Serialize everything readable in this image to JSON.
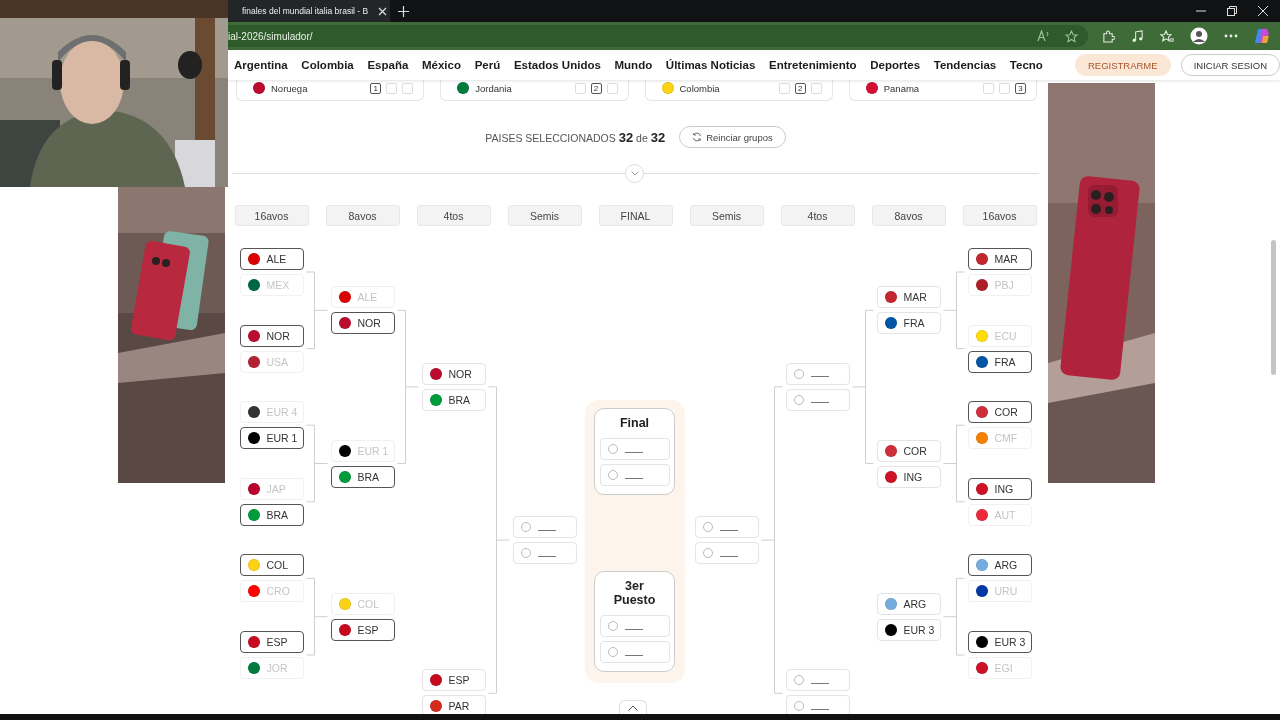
{
  "browser": {
    "tab_title": "finales del mundial italia brasil - B",
    "url": "ial-2026/simulador/"
  },
  "nav": {
    "links": [
      "Argentina",
      "Colombia",
      "España",
      "México",
      "Perú",
      "Estados Unidos",
      "Mundo",
      "Últimas Noticias",
      "Entretenimiento",
      "Deportes",
      "Tendencias",
      "Tecno"
    ],
    "register": "REGISTRARME",
    "login": "INICIAR SESION"
  },
  "groups": [
    {
      "name": "Noruega",
      "color": "#ba0c2f",
      "boxes": [
        {
          "kind": "number",
          "text": "1"
        },
        {
          "kind": "blank"
        },
        {
          "kind": "blank"
        }
      ]
    },
    {
      "name": "Jordania",
      "color": "#007a3d",
      "boxes": [
        {
          "kind": "blank"
        },
        {
          "kind": "number",
          "text": "2"
        },
        {
          "kind": "blank"
        }
      ]
    },
    {
      "name": "Colombia",
      "color": "#fcd116",
      "boxes": [
        {
          "kind": "blank"
        },
        {
          "kind": "number",
          "text": "2"
        },
        {
          "kind": "blank"
        }
      ]
    },
    {
      "name": "Panama",
      "color": "#d21034",
      "boxes": [
        {
          "kind": "blank"
        },
        {
          "kind": "blank"
        },
        {
          "kind": "number",
          "text": "3"
        }
      ]
    }
  ],
  "summary": {
    "label": "PAISES SELECCIONADOS",
    "count": "32",
    "joiner": "de",
    "total": "32",
    "reset_button": "Reinciar grupos"
  },
  "round_headers": [
    "16avos",
    "8avos",
    "4tos",
    "Semis",
    "FINAL",
    "Semis",
    "4tos",
    "8avos",
    "16avos"
  ],
  "bracket": {
    "left": [
      [
        {
          "kind": "team",
          "code": "ALE",
          "selected": true,
          "eliminated": false,
          "color": "#dd0000"
        },
        {
          "kind": "team",
          "code": "MEX",
          "selected": false,
          "eliminated": true,
          "color": "#006847"
        },
        {
          "kind": "team",
          "code": "NOR",
          "selected": true,
          "eliminated": false,
          "color": "#ba0c2f"
        },
        {
          "kind": "team",
          "code": "USA",
          "selected": false,
          "eliminated": true,
          "color": "#b22234"
        },
        {
          "kind": "team",
          "code": "EUR 4",
          "selected": false,
          "eliminated": true,
          "color": "#333333"
        },
        {
          "kind": "team",
          "code": "EUR 1",
          "selected": true,
          "eliminated": false,
          "color": "#000000"
        },
        {
          "kind": "team",
          "code": "JAP",
          "selected": false,
          "eliminated": true,
          "color": "#bc002d"
        },
        {
          "kind": "team",
          "code": "BRA",
          "selected": true,
          "eliminated": false,
          "color": "#009c3b"
        },
        {
          "kind": "team",
          "code": "COL",
          "selected": true,
          "eliminated": false,
          "color": "#fcd116"
        },
        {
          "kind": "team",
          "code": "CRO",
          "selected": false,
          "eliminated": true,
          "color": "#ff0000"
        },
        {
          "kind": "team",
          "code": "ESP",
          "selected": true,
          "eliminated": false,
          "color": "#c60b1e"
        },
        {
          "kind": "team",
          "code": "JOR",
          "selected": false,
          "eliminated": true,
          "color": "#007a3d"
        }
      ],
      [
        {
          "kind": "team",
          "code": "ALE",
          "selected": false,
          "eliminated": true,
          "color": "#dd0000"
        },
        {
          "kind": "team",
          "code": "NOR",
          "selected": true,
          "eliminated": false,
          "color": "#ba0c2f"
        },
        {
          "kind": "team",
          "code": "EUR 1",
          "selected": false,
          "eliminated": true,
          "color": "#000000"
        },
        {
          "kind": "team",
          "code": "BRA",
          "selected": true,
          "eliminated": false,
          "color": "#009c3b"
        },
        {
          "kind": "team",
          "code": "COL",
          "selected": false,
          "eliminated": true,
          "color": "#fcd116"
        },
        {
          "kind": "team",
          "code": "ESP",
          "selected": true,
          "eliminated": false,
          "color": "#c60b1e"
        }
      ],
      [
        {
          "kind": "team",
          "code": "NOR",
          "selected": false,
          "eliminated": false,
          "color": "#ba0c2f"
        },
        {
          "kind": "team",
          "code": "BRA",
          "selected": false,
          "eliminated": false,
          "color": "#009c3b"
        },
        {
          "kind": "team",
          "code": "ESP",
          "selected": false,
          "eliminated": false,
          "color": "#c60b1e"
        },
        {
          "kind": "team",
          "code": "PAR",
          "selected": false,
          "eliminated": false,
          "color": "#d52b1e"
        }
      ],
      [
        {
          "kind": "empty",
          "checked": false
        },
        {
          "kind": "empty",
          "checked": false
        }
      ]
    ],
    "right": [
      [
        {
          "kind": "empty",
          "checked": false
        },
        {
          "kind": "empty",
          "checked": false
        }
      ],
      [
        {
          "kind": "empty",
          "checked": false
        },
        {
          "kind": "empty",
          "checked": false
        },
        {
          "kind": "empty",
          "checked": false
        },
        {
          "kind": "empty",
          "checked": false
        }
      ],
      [
        {
          "kind": "team",
          "code": "MAR",
          "selected": false,
          "eliminated": false,
          "color": "#c1272d"
        },
        {
          "kind": "team",
          "code": "FRA",
          "selected": false,
          "eliminated": false,
          "color": "#0055a4"
        },
        {
          "kind": "team",
          "code": "COR",
          "selected": false,
          "eliminated": false,
          "color": "#cd2e3a"
        },
        {
          "kind": "team",
          "code": "ING",
          "selected": false,
          "eliminated": false,
          "color": "#ce1124"
        },
        {
          "kind": "team",
          "code": "ARG",
          "selected": false,
          "eliminated": false,
          "color": "#74acdf"
        },
        {
          "kind": "team",
          "code": "EUR 3",
          "selected": false,
          "eliminated": false,
          "color": "#000000"
        }
      ],
      [
        {
          "kind": "team",
          "code": "MAR",
          "selected": true,
          "eliminated": false,
          "color": "#c1272d"
        },
        {
          "kind": "team",
          "code": "PBJ",
          "selected": false,
          "eliminated": true,
          "color": "#ae1c28"
        },
        {
          "kind": "team",
          "code": "ECU",
          "selected": false,
          "eliminated": true,
          "color": "#ffdd00"
        },
        {
          "kind": "team",
          "code": "FRA",
          "selected": true,
          "eliminated": false,
          "color": "#0055a4"
        },
        {
          "kind": "team",
          "code": "COR",
          "selected": true,
          "eliminated": false,
          "color": "#cd2e3a"
        },
        {
          "kind": "team",
          "code": "CMF",
          "selected": false,
          "eliminated": true,
          "color": "#f77f00"
        },
        {
          "kind": "team",
          "code": "ING",
          "selected": true,
          "eliminated": false,
          "color": "#ce1124"
        },
        {
          "kind": "team",
          "code": "AUT",
          "selected": false,
          "eliminated": true,
          "color": "#ed2939"
        },
        {
          "kind": "team",
          "code": "ARG",
          "selected": true,
          "eliminated": false,
          "color": "#74acdf"
        },
        {
          "kind": "team",
          "code": "URU",
          "selected": false,
          "eliminated": true,
          "color": "#0038a8"
        },
        {
          "kind": "team",
          "code": "EUR 3",
          "selected": true,
          "eliminated": false,
          "color": "#000000"
        },
        {
          "kind": "team",
          "code": "EGI",
          "selected": false,
          "eliminated": true,
          "color": "#ce1126"
        }
      ]
    ]
  },
  "final": {
    "title": "Final",
    "slots": [
      {
        "kind": "empty",
        "checked": false
      },
      {
        "kind": "empty",
        "checked": false
      }
    ]
  },
  "third_place": {
    "title": "3er Puesto",
    "slots": [
      {
        "kind": "empty",
        "checked": false
      },
      {
        "kind": "empty",
        "checked": false
      }
    ]
  }
}
